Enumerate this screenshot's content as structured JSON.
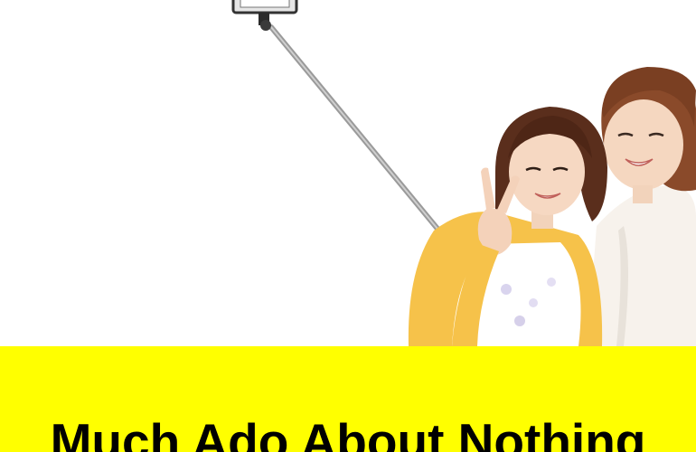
{
  "colors": {
    "background": "#ffffff",
    "banner": "#ffff00",
    "title_text": "#000000"
  },
  "banner": {
    "title": "Much Ado About Nothing"
  },
  "photo": {
    "subject": "two-women-selfie-stick"
  }
}
